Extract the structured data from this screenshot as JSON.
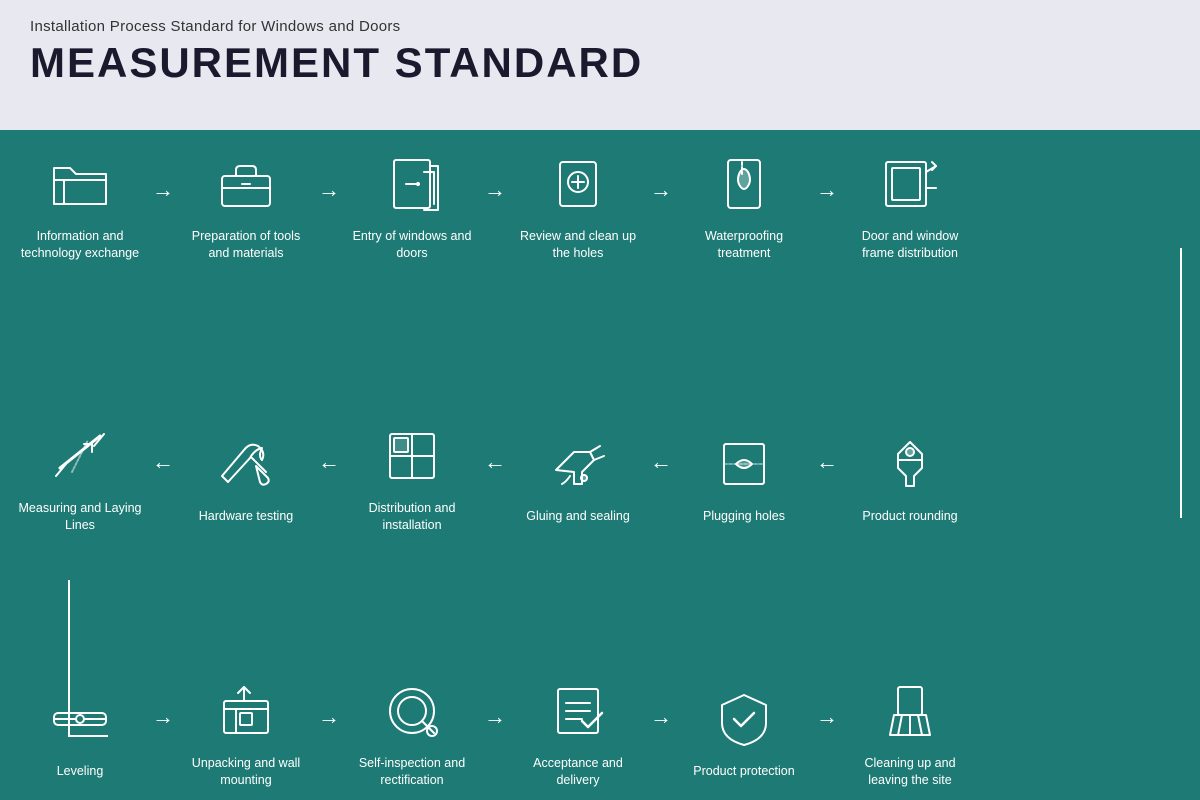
{
  "header": {
    "subtitle": "Installation Process Standard for Windows and Doors",
    "title": "MEASUREMENT STANDARD"
  },
  "row1": [
    {
      "id": "info-tech",
      "label": "Information and technology exchange",
      "icon": "folder"
    },
    {
      "id": "prep-tools",
      "label": "Preparation of tools and materials",
      "icon": "toolbox"
    },
    {
      "id": "entry-doors",
      "label": "Entry of windows and doors",
      "icon": "door-entry"
    },
    {
      "id": "review-holes",
      "label": "Review and clean up the holes",
      "icon": "magnifier"
    },
    {
      "id": "waterproofing",
      "label": "Waterproofing treatment",
      "icon": "waterproof"
    },
    {
      "id": "frame-dist",
      "label": "Door and window frame distribution",
      "icon": "frame-export"
    }
  ],
  "row2": [
    {
      "id": "measuring",
      "label": "Measuring and Laying Lines",
      "icon": "ruler-cross"
    },
    {
      "id": "hardware",
      "label": "Hardware testing",
      "icon": "wrench-screwdriver"
    },
    {
      "id": "distribution",
      "label": "Distribution and installation",
      "icon": "grid-install"
    },
    {
      "id": "gluing",
      "label": "Gluing and sealing",
      "icon": "glue-gun"
    },
    {
      "id": "plugging",
      "label": "Plugging holes",
      "icon": "plug-hole"
    },
    {
      "id": "rounding",
      "label": "Product rounding",
      "icon": "pin-round"
    }
  ],
  "row3": [
    {
      "id": "leveling",
      "label": "Leveling",
      "icon": "level"
    },
    {
      "id": "unpacking",
      "label": "Unpacking and wall mounting",
      "icon": "unpack"
    },
    {
      "id": "self-inspect",
      "label": "Self-inspection and rectification",
      "icon": "self-inspect"
    },
    {
      "id": "acceptance",
      "label": "Acceptance and delivery",
      "icon": "accept"
    },
    {
      "id": "protection",
      "label": "Product protection",
      "icon": "shield-check"
    },
    {
      "id": "cleanup",
      "label": "Cleaning up and leaving the site",
      "icon": "broom"
    }
  ],
  "colors": {
    "bg_main": "#1d7a74",
    "bg_header": "#e8e8f0",
    "text_white": "#ffffff",
    "title_dark": "#1a1a2e"
  }
}
